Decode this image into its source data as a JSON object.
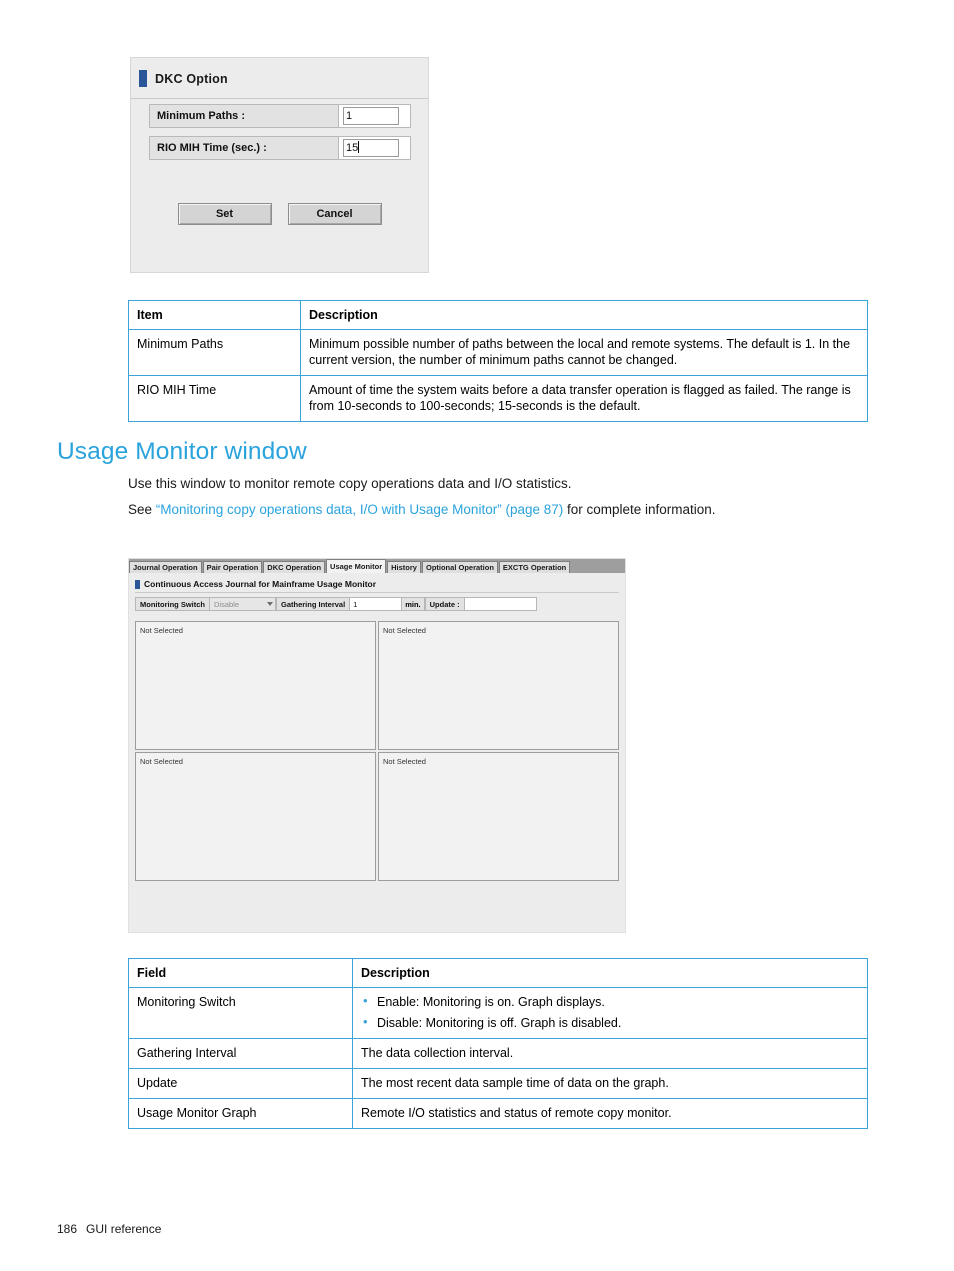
{
  "dkc_dialog": {
    "title": "DKC Option",
    "fields": [
      {
        "label": "Minimum Paths :",
        "value": "1"
      },
      {
        "label": "RIO MIH Time (sec.) :",
        "value": "15"
      }
    ],
    "buttons": {
      "set": "Set",
      "cancel": "Cancel"
    }
  },
  "table_item": {
    "headers": [
      "Item",
      "Description"
    ],
    "rows": [
      {
        "item": "Minimum Paths",
        "description": "Minimum possible number of paths between the local and remote systems. The default is 1. In the current version, the number of minimum paths cannot be changed."
      },
      {
        "item": "RIO MIH Time",
        "description": "Amount of time the system waits before a data transfer operation is flagged as failed. The range is from 10-seconds to 100-seconds; 15-seconds is the default."
      }
    ]
  },
  "section": {
    "heading": "Usage Monitor window",
    "paragraph_1": "Use this window to monitor remote copy operations data and I/O statistics.",
    "paragraph_2_prefix": "See ",
    "paragraph_2_link": "“Monitoring copy operations data, I/O with Usage Monitor” (page 87)",
    "paragraph_2_suffix": " for complete information."
  },
  "app_shot": {
    "tabs": [
      "Journal Operation",
      "Pair Operation",
      "DKC Operation",
      "Usage Monitor",
      "History",
      "Optional Operation",
      "EXCTG Operation"
    ],
    "active_tab": "Usage Monitor",
    "panel_title": "Continuous Access Journal for Mainframe Usage Monitor",
    "controls": {
      "monitoring_switch_label": "Monitoring Switch",
      "monitoring_switch_value": "Disable",
      "gathering_interval_label": "Gathering Interval",
      "gathering_interval_value": "1",
      "gathering_interval_unit": "min.",
      "update_label": "Update :",
      "update_value": ""
    },
    "graph_panes": [
      "Not Selected",
      "Not Selected",
      "Not Selected",
      "Not Selected"
    ]
  },
  "table_field": {
    "headers": [
      "Field",
      "Description"
    ],
    "rows": [
      {
        "field": "Monitoring Switch",
        "bullets": [
          "Enable: Monitoring is on. Graph displays.",
          "Disable: Monitoring is off. Graph is disabled."
        ]
      },
      {
        "field": "Gathering Interval",
        "description": "The data collection interval."
      },
      {
        "field": "Update",
        "description": "The most recent data sample time of data on the graph."
      },
      {
        "field": "Usage Monitor Graph",
        "description": "Remote I/O statistics and status of remote copy monitor."
      }
    ]
  },
  "footer": {
    "page_number": "186",
    "section_label": "GUI reference"
  },
  "colors": {
    "accent": "#2aa3dd",
    "table_border": "#3aa3d8",
    "dialog_marker": "#2a5699"
  }
}
